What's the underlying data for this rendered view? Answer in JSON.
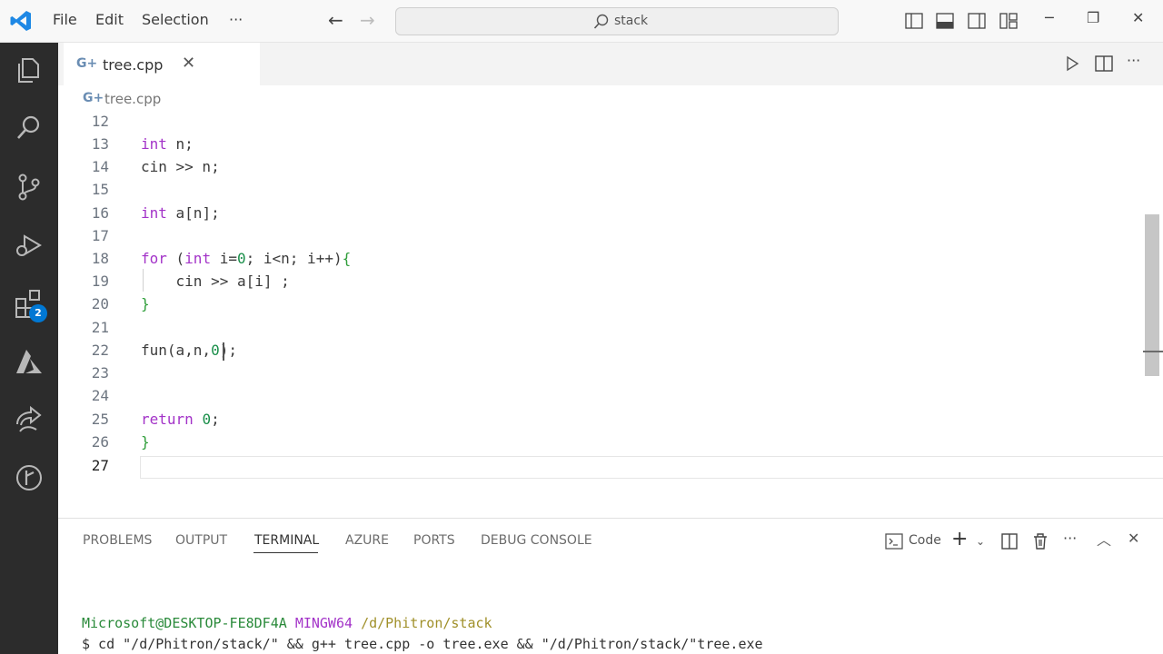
{
  "titlebar": {
    "menus": [
      "File",
      "Edit",
      "Selection",
      "···"
    ],
    "search_text": "stack",
    "window_controls": [
      "─",
      "❐",
      "✕"
    ]
  },
  "activity_bar": {
    "icons": [
      "explorer-icon",
      "search-icon",
      "source-control-icon",
      "run-debug-icon",
      "extensions-icon",
      "azure-icon",
      "remote-icon",
      "timeline-icon"
    ],
    "extensions_badge": "2"
  },
  "tab": {
    "icon_glyph": "G+",
    "label": "tree.cpp",
    "close": "✕"
  },
  "breadcrumb": {
    "icon_glyph": "G+",
    "file": "tree.cpp"
  },
  "editor": {
    "lines": [
      {
        "n": "12",
        "code": ""
      },
      {
        "n": "13",
        "code": "int n;"
      },
      {
        "n": "14",
        "code": "cin >> n;"
      },
      {
        "n": "15",
        "code": ""
      },
      {
        "n": "16",
        "code": "int a[n];"
      },
      {
        "n": "17",
        "code": ""
      },
      {
        "n": "18",
        "code": "for (int i=0; i<n; i++){"
      },
      {
        "n": "19",
        "code": "    cin >> a[i] ;"
      },
      {
        "n": "20",
        "code": "}"
      },
      {
        "n": "21",
        "code": ""
      },
      {
        "n": "22",
        "code": "fun(a,n,0);"
      },
      {
        "n": "23",
        "code": ""
      },
      {
        "n": "24",
        "code": ""
      },
      {
        "n": "25",
        "code": "return 0;"
      },
      {
        "n": "26",
        "code": "}"
      },
      {
        "n": "27",
        "code": ""
      }
    ]
  },
  "panel": {
    "tabs": [
      "PROBLEMS",
      "OUTPUT",
      "TERMINAL",
      "AZURE",
      "PORTS",
      "DEBUG CONSOLE"
    ],
    "active_tab": "TERMINAL",
    "terminal_name": "Code",
    "terminal": {
      "user_host": "Microsoft@DESKTOP-FE8DF4A",
      "shell": "MINGW64",
      "path": "/d/Phitron/stack",
      "command": "$ cd \"/d/Phitron/stack/\" && g++ tree.cpp -o tree.exe && \"/d/Phitron/stack/\"tree.exe"
    }
  },
  "colors": {
    "keyword": "#a333c8",
    "number": "#1a8f4a",
    "activity_bg": "#2c2c2c",
    "accent": "#0078d4"
  }
}
